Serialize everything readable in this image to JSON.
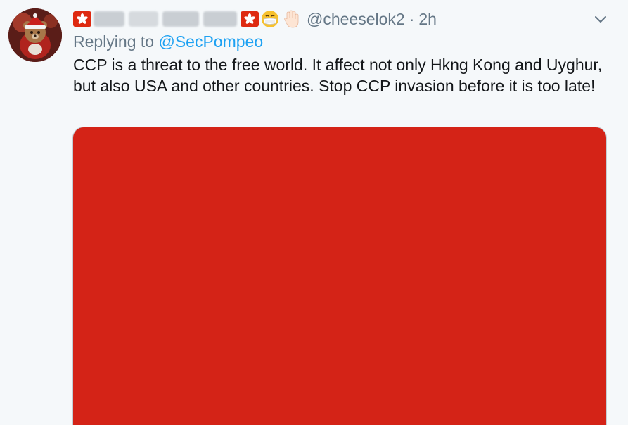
{
  "tweet": {
    "display_name_redacted": "",
    "handle": "@cheeselok2",
    "separator": "·",
    "timestamp": "2h",
    "replying_prefix": "Replying to ",
    "replying_to": "@SecPompeo",
    "text": "CCP is a threat to the free world. It affect not only Hkng Kong and Uyghur, but also USA and other countries. Stop CCP invasion before it is too late!",
    "media_color": "#d42317"
  },
  "icons": [
    "hong-kong-flag-icon",
    "mask-face-icon",
    "raised-hand-icon",
    "chevron-down-icon"
  ],
  "colors": {
    "background": "#f5f8fa",
    "secondary_text": "#657786",
    "link": "#1da1f2",
    "primary_text": "#14171a",
    "flag_red": "#de2910"
  }
}
